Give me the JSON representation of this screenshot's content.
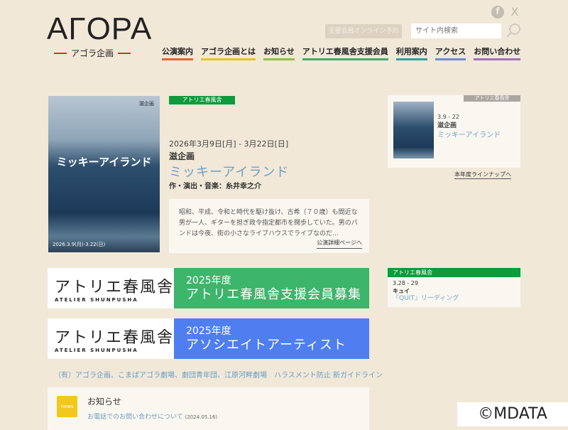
{
  "logo": {
    "main": "AΓOPA",
    "sub": "アゴラ企画"
  },
  "header": {
    "reserve": "支援会員オンライン予約",
    "search_placeholder": "サイト内検索",
    "social": [
      "f",
      "X"
    ]
  },
  "nav": [
    {
      "label": "公演案内",
      "color": "#e8652c"
    },
    {
      "label": "アゴラ企画とは",
      "color": "#e8c41c"
    },
    {
      "label": "お知らせ",
      "color": "#8cc43c"
    },
    {
      "label": "アトリエ春風舎支援会員",
      "color": "#3cb06a"
    },
    {
      "label": "利用案内",
      "color": "#2ca0a8"
    },
    {
      "label": "アクセス",
      "color": "#6a8ed8"
    },
    {
      "label": "お問い合わせ",
      "color": "#a070c0"
    }
  ],
  "featured": {
    "venue": "アトリエ春風舎",
    "date": "2026年3月9日[月] - 3月22日[日]",
    "org": "滋企画",
    "title": "ミッキーアイランド",
    "credit": "作・演出・音楽：糸井幸之介",
    "poster_title": "ミッキーアイランド",
    "poster_company": "滋企画",
    "poster_date": "2026.3.9(月)-3.22(日)",
    "desc": "昭和、平成、令和と時代を駆け抜け、古希（７０歳）も間近な男が一人、ギターを担ぎ政令指定都市を闊歩していた。男のバンドは今夜、街の小さなライブハウスでライブなのだ…",
    "more": "公演詳細ページへ"
  },
  "side": {
    "tag": "アトリエ春風舎",
    "date": "3.9 - 22",
    "org": "滋企画",
    "title": "ミッキーアイランド",
    "lineup": "本年度ラインナップへ"
  },
  "banners": [
    {
      "jp": "アトリエ春風舎",
      "en": "ATELIER SHUNPUSHA",
      "year": "2025年度",
      "msg": "アトリエ春風舎支援会員募集",
      "color": "#3db56a"
    },
    {
      "jp": "アトリエ春風舎",
      "en": "ATELIER SHUNPUSHA",
      "year": "2025年度",
      "msg": "アソシエイトアーティスト",
      "color": "#4f7ef0"
    }
  ],
  "links": "（有）アゴラ企画、こまばアゴラ劇場、劇団青年団、江原河畔劇場　ハラスメント防止 新ガイドライン",
  "news": {
    "icon": "news",
    "heading": "お知らせ",
    "item": "お電話でのお問い合わせについて",
    "item_date": "(2024.05.16)"
  },
  "side2": {
    "tag": "アトリエ春風舎",
    "date": "3.28 - 29",
    "org": "キュイ",
    "title": "『QUIT』リーディング"
  },
  "watermark": "©MDATA"
}
